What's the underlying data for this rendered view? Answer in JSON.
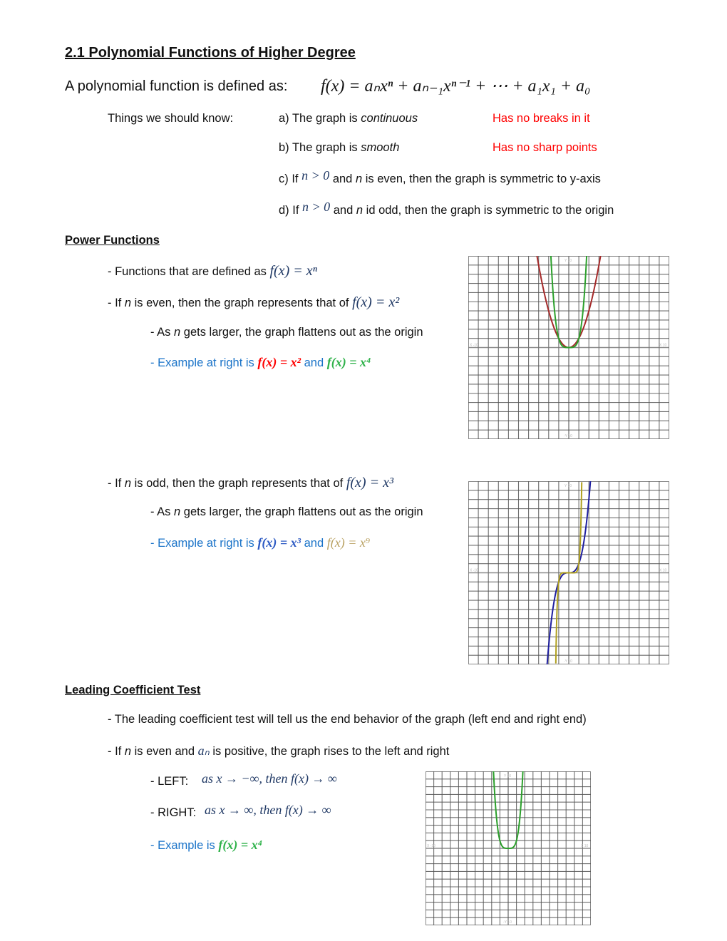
{
  "title": "2.1 Polynomial Functions of Higher Degree",
  "definition": {
    "lead": "A polynomial function is defined as:",
    "formula": "f(x) = aₙxⁿ + aₙ₋₁xⁿ⁻¹ + ⋯ + a₁x₁ + a₀"
  },
  "things_to_know": {
    "label": "Things we should know:",
    "items": [
      {
        "prefix": "a) The graph is ",
        "emph": "continuous",
        "note": "Has no breaks in it"
      },
      {
        "prefix": "b) The graph is ",
        "emph": "smooth",
        "note": "Has no sharp points"
      },
      {
        "prefix": "c) If ",
        "math": "n > 0",
        "mid": " and ",
        "n": "n",
        "suffix": " is even, then the graph is symmetric to y-axis"
      },
      {
        "prefix": "d) If ",
        "math": "n > 0",
        "mid": " and ",
        "n": "n",
        "suffix": " id odd, then the graph is symmetric to the origin"
      }
    ]
  },
  "power_functions": {
    "heading": "Power Functions",
    "line1": {
      "text": "- Functions that are defined as ",
      "math": "f(x) = xⁿ"
    },
    "even": {
      "pre": "- If ",
      "n": "n",
      "text": " is even, then the graph represents that of ",
      "math": "f(x) = x²",
      "flatten": {
        "pre": "- As ",
        "n": "n",
        "text": " gets larger, the graph flattens out as the origin"
      },
      "example": {
        "text": "- Example at right is ",
        "f1": "f(x) = x²",
        "and": " and ",
        "f2": "f(x) = x⁴"
      }
    },
    "odd": {
      "pre": "- If ",
      "n": "n",
      "text": " is odd, then the graph represents that of ",
      "math": "f(x) = x³",
      "flatten": {
        "pre": "- As ",
        "n": "n",
        "text": " gets larger, the graph flattens out as the origin"
      },
      "example": {
        "text": "- Example at right is ",
        "f1": "f(x) = x³",
        "and": " and ",
        "f2": "f(x) = x⁹"
      }
    }
  },
  "leading_coefficient": {
    "heading": "Leading Coefficient Test",
    "line1": "- The leading coefficient test will tell us the end behavior of the graph (left end and right end)",
    "line2": {
      "pre": "- If ",
      "n": "n",
      "mid": " is even and ",
      "an": "aₙ",
      "text": " is positive, the graph rises to the left and right"
    },
    "left": {
      "label": "- LEFT:",
      "math": "as x → −∞, then f(x) → ∞"
    },
    "right": {
      "label": "- RIGHT:",
      "math": "as x → ∞, then f(x) → ∞"
    },
    "example": {
      "text": "- Example is ",
      "f": "f(x) = x⁴"
    }
  },
  "colors": {
    "red_note": "#ff0000",
    "example_blue": "#1a73c8",
    "x2_curve": "#a52a2a",
    "x4_curve": "#2ca02c",
    "x3_curve": "#1f1fa0",
    "x9_curve": "#b0a020",
    "grid": "#555555"
  },
  "chart_data": [
    {
      "type": "line",
      "title": "",
      "xlim": [
        -10,
        10
      ],
      "ylim": [
        -10,
        10
      ],
      "grid": true,
      "axis_labels": {
        "x_min": "X -10",
        "x_max": "X 10",
        "y_max": "Y 10",
        "y_min": "-Y 10"
      },
      "series": [
        {
          "name": "f(x) = x^2",
          "exponent": 2,
          "color": "#a52a2a"
        },
        {
          "name": "f(x) = x^4",
          "exponent": 4,
          "color": "#2ca02c"
        }
      ]
    },
    {
      "type": "line",
      "title": "",
      "xlim": [
        -10,
        10
      ],
      "ylim": [
        -10,
        10
      ],
      "grid": true,
      "axis_labels": {
        "x_min": "X -10",
        "x_max": "X 10",
        "y_max": "Y 10",
        "y_min": "-Y 10"
      },
      "series": [
        {
          "name": "f(x) = x^3",
          "exponent": 3,
          "color": "#1f1fa0"
        },
        {
          "name": "f(x) = x^9",
          "exponent": 9,
          "color": "#b0a020"
        }
      ]
    },
    {
      "type": "line",
      "title": "",
      "xlim": [
        -10,
        10
      ],
      "ylim": [
        -10,
        10
      ],
      "grid": true,
      "axis_labels": {
        "x_min": "X -10",
        "x_max": "X 10",
        "y_max": "Y 10",
        "y_min": "-Y 10"
      },
      "series": [
        {
          "name": "f(x) = x^4",
          "exponent": 4,
          "color": "#2ca02c"
        }
      ]
    }
  ]
}
